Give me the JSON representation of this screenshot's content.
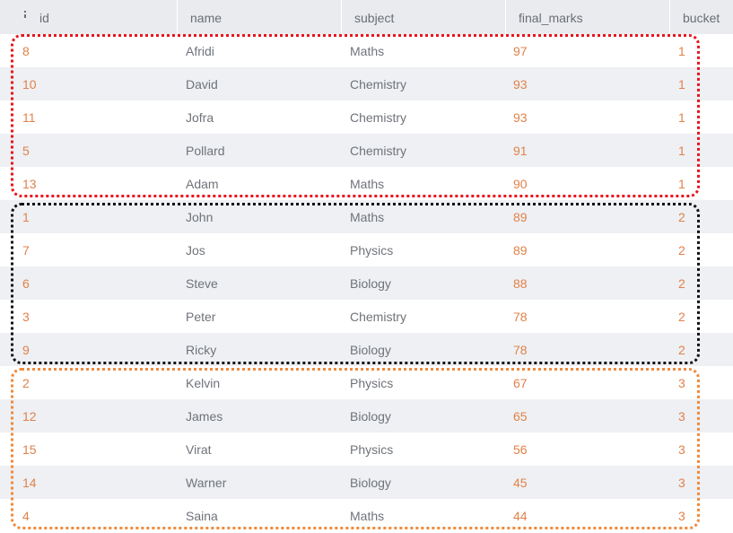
{
  "table": {
    "columns": [
      {
        "key": "id",
        "label": "id"
      },
      {
        "key": "name",
        "label": "name"
      },
      {
        "key": "subject",
        "label": "subject"
      },
      {
        "key": "final_marks",
        "label": "final_marks"
      },
      {
        "key": "bucket",
        "label": "bucket"
      }
    ],
    "rows": [
      {
        "id": "8",
        "name": "Afridi",
        "subject": "Maths",
        "final_marks": "97",
        "bucket": "1"
      },
      {
        "id": "10",
        "name": "David",
        "subject": "Chemistry",
        "final_marks": "93",
        "bucket": "1"
      },
      {
        "id": "11",
        "name": "Jofra",
        "subject": "Chemistry",
        "final_marks": "93",
        "bucket": "1"
      },
      {
        "id": "5",
        "name": "Pollard",
        "subject": "Chemistry",
        "final_marks": "91",
        "bucket": "1"
      },
      {
        "id": "13",
        "name": "Adam",
        "subject": "Maths",
        "final_marks": "90",
        "bucket": "1"
      },
      {
        "id": "1",
        "name": "John",
        "subject": "Maths",
        "final_marks": "89",
        "bucket": "2"
      },
      {
        "id": "7",
        "name": "Jos",
        "subject": "Physics",
        "final_marks": "89",
        "bucket": "2"
      },
      {
        "id": "6",
        "name": "Steve",
        "subject": "Biology",
        "final_marks": "88",
        "bucket": "2"
      },
      {
        "id": "3",
        "name": "Peter",
        "subject": "Chemistry",
        "final_marks": "78",
        "bucket": "2"
      },
      {
        "id": "9",
        "name": "Ricky",
        "subject": "Biology",
        "final_marks": "78",
        "bucket": "2"
      },
      {
        "id": "2",
        "name": "Kelvin",
        "subject": "Physics",
        "final_marks": "67",
        "bucket": "3"
      },
      {
        "id": "12",
        "name": "James",
        "subject": "Biology",
        "final_marks": "65",
        "bucket": "3"
      },
      {
        "id": "15",
        "name": "Virat",
        "subject": "Physics",
        "final_marks": "56",
        "bucket": "3"
      },
      {
        "id": "14",
        "name": "Warner",
        "subject": "Biology",
        "final_marks": "45",
        "bucket": "3"
      },
      {
        "id": "4",
        "name": "Saina",
        "subject": "Maths",
        "final_marks": "44",
        "bucket": "3"
      }
    ]
  },
  "highlight_groups": [
    {
      "bucket": "1",
      "color": "#e8141c"
    },
    {
      "bucket": "2",
      "color": "#111111"
    },
    {
      "bucket": "3",
      "color": "#ef8a3c"
    }
  ],
  "icons": {
    "id_header": "sort-order-icon"
  }
}
